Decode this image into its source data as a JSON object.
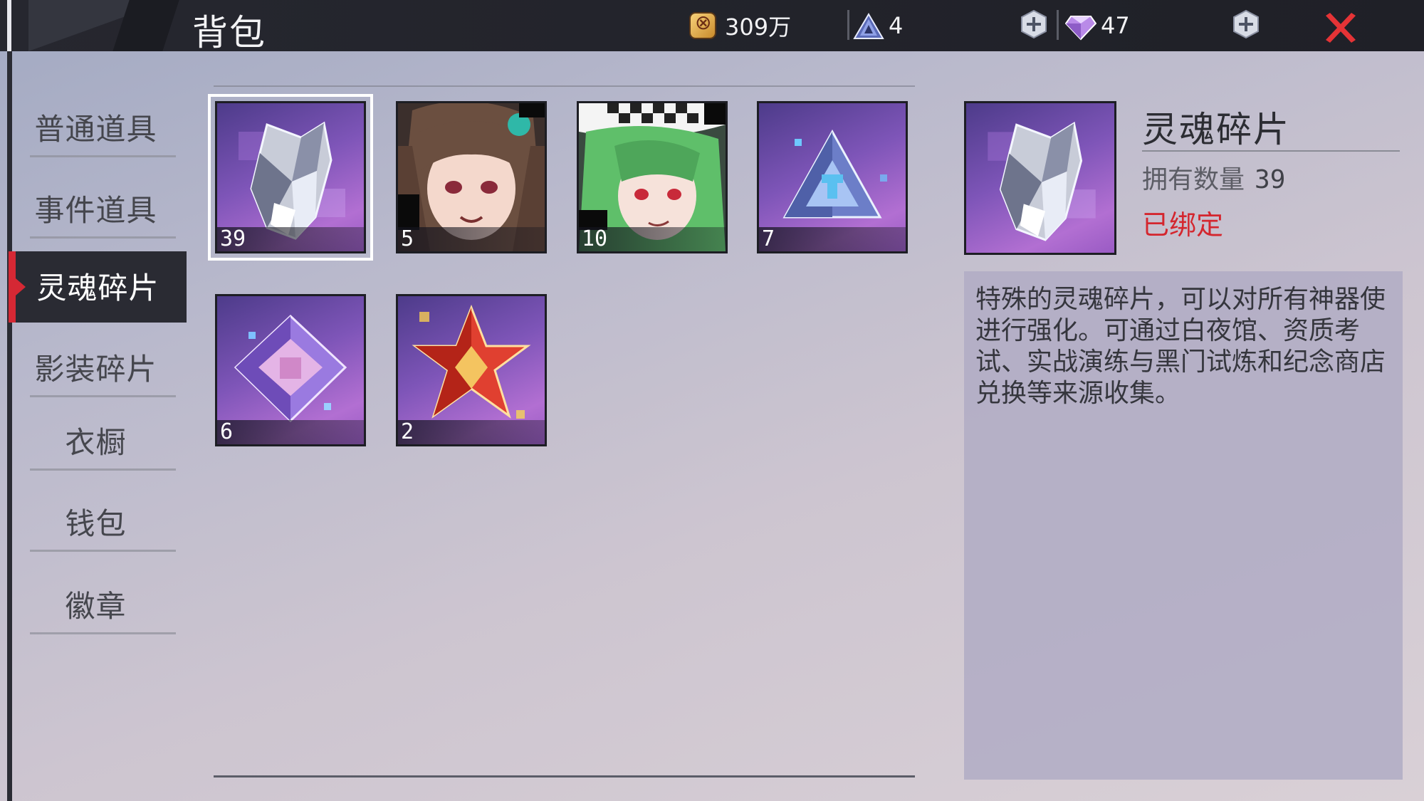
{
  "header": {
    "title": "背包",
    "gold": {
      "icon": "gold-coin-icon",
      "value": "309万"
    },
    "stamina": {
      "icon": "pyramid-crystal-icon",
      "value": "4"
    },
    "diamond": {
      "icon": "diamond-icon",
      "value": "47"
    },
    "add_icon": "plus-circle-icon",
    "close_icon": "close-x-icon"
  },
  "sidebar": {
    "items": [
      {
        "label": "普通道具",
        "active": false
      },
      {
        "label": "事件道具",
        "active": false
      },
      {
        "label": "灵魂碎片",
        "active": true
      },
      {
        "label": "影装碎片",
        "active": false
      },
      {
        "label": "衣橱",
        "active": false
      },
      {
        "label": "钱包",
        "active": false
      },
      {
        "label": "徽章",
        "active": false
      }
    ]
  },
  "items": [
    {
      "icon": "crystal-shard-icon",
      "count": "39",
      "selected": true
    },
    {
      "icon": "brown-hair-girl-portrait",
      "count": "5",
      "selected": false
    },
    {
      "icon": "green-hair-girl-portrait",
      "count": "10",
      "selected": false
    },
    {
      "icon": "blue-pyramid-crystal-icon",
      "count": "7",
      "selected": false
    },
    {
      "icon": "purple-diamond-crystal-icon",
      "count": "6",
      "selected": false
    },
    {
      "icon": "red-star-crystal-icon",
      "count": "2",
      "selected": false
    }
  ],
  "detail": {
    "icon": "crystal-shard-icon",
    "name": "灵魂碎片",
    "owned_label": "拥有数量",
    "owned_count": "39",
    "bound_label": "已绑定",
    "description": "特殊的灵魂碎片，可以对所有神器使进行强化。可通过白夜馆、资质考试、实战演练与黑门试炼和纪念商店兑换等来源收集。"
  },
  "colors": {
    "topbar": "#26272f",
    "active_marker": "#d52834",
    "bound_text": "#d4262e",
    "close_icon": "#e53336"
  }
}
